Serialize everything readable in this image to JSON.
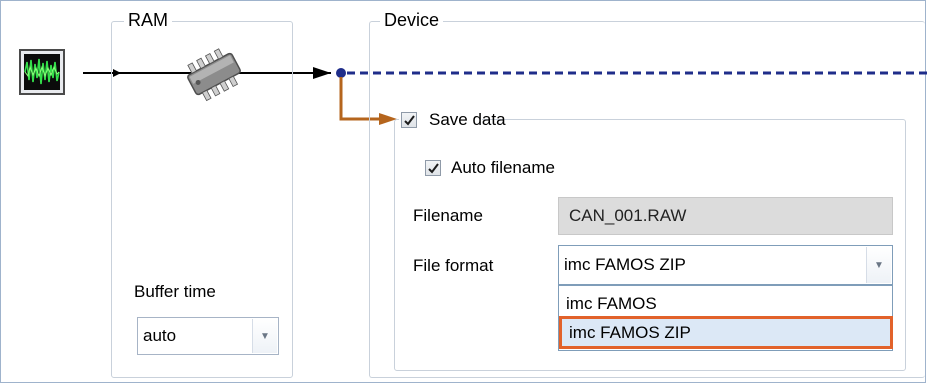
{
  "ram_group": {
    "title": "RAM",
    "buffer_time_label": "Buffer time",
    "buffer_time_value": "auto"
  },
  "device_group": {
    "title": "Device",
    "save_data_label": "Save data",
    "save_data_checked": true,
    "auto_filename_label": "Auto filename",
    "auto_filename_checked": true,
    "filename_label": "Filename",
    "filename_value": "CAN_001.RAW",
    "file_format_label": "File format",
    "file_format_value": "imc FAMOS ZIP",
    "file_format_options": [
      "imc FAMOS",
      "imc FAMOS ZIP"
    ],
    "file_format_highlighted": "imc FAMOS ZIP"
  },
  "icons": {
    "signal": "oscilloscope-signal-icon",
    "ram_chip": "ram-chip-icon"
  },
  "colors": {
    "signal_line": "#000000",
    "save_branch": "#b5651d",
    "device_output": "#1f2d8a",
    "selection_outline": "#e2622a"
  }
}
